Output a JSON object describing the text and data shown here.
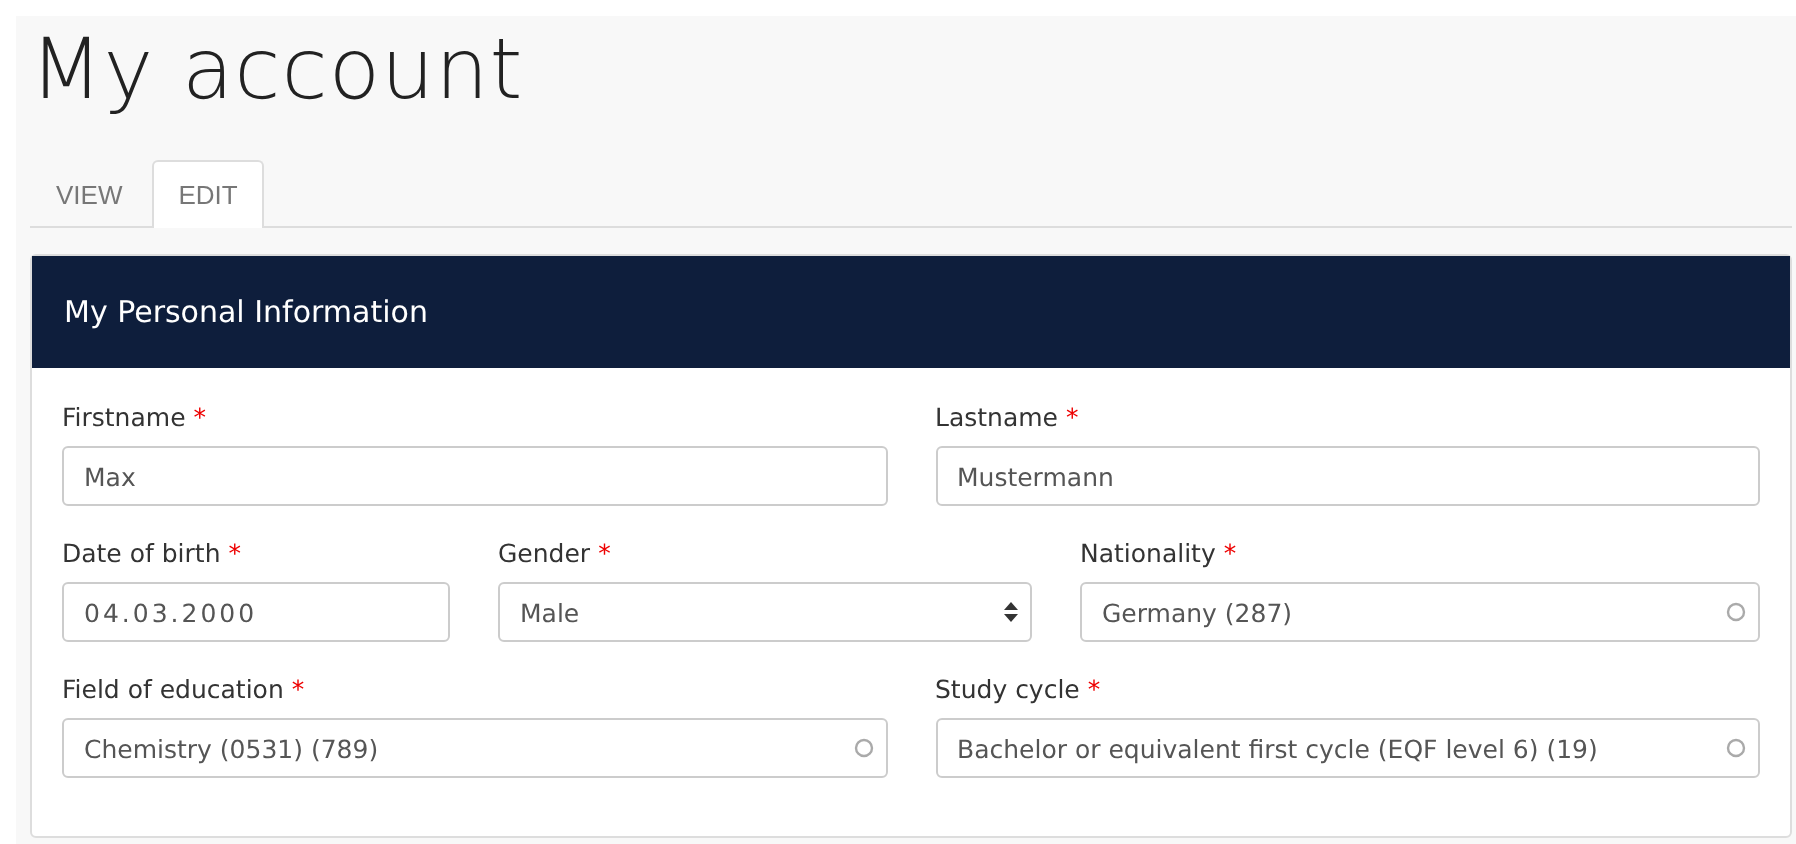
{
  "page_title": "My account",
  "tabs": [
    {
      "label": "VIEW",
      "selected": false
    },
    {
      "label": "EDIT",
      "selected": true
    }
  ],
  "panel": {
    "title": "My Personal Information",
    "rows": [
      [
        {
          "label": "Firstname",
          "mark": "*",
          "kind": "text",
          "value": "Max"
        },
        {
          "label": "Lastname",
          "mark": "*",
          "kind": "text",
          "value": "Mustermann"
        }
      ],
      [
        {
          "label": "Date of birth",
          "mark": "*",
          "kind": "date",
          "value": "04.03.2000"
        },
        {
          "label": "Gender",
          "mark": "*",
          "kind": "select",
          "value": "Male"
        },
        {
          "label": "Nationality",
          "mark": "*",
          "kind": "lookup",
          "value": "Germany (287)"
        }
      ],
      [
        {
          "label": "Field of education",
          "mark": "*",
          "kind": "lookup",
          "value": "Chemistry (0531) (789)"
        },
        {
          "label": "Study cycle",
          "mark": "*",
          "kind": "lookup",
          "value": "Bachelor or equivalent first cycle (EQF level 6) (19)"
        }
      ]
    ]
  }
}
